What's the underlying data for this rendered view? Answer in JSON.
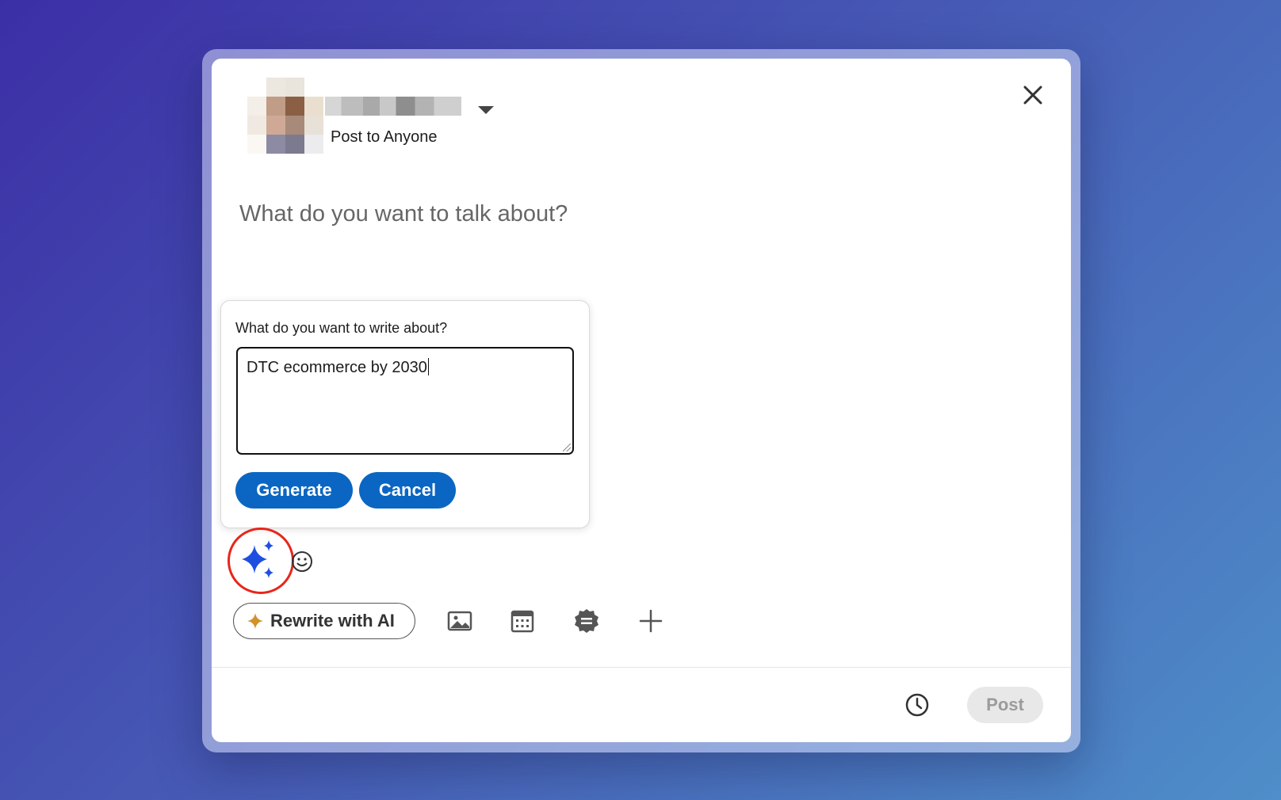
{
  "composer": {
    "audience_label": "Post to Anyone",
    "placeholder": "What do you want to talk about?"
  },
  "ai_prompt": {
    "label": "What do you want to write about?",
    "input_value": "DTC ecommerce by 2030",
    "generate_label": "Generate",
    "cancel_label": "Cancel"
  },
  "toolbar": {
    "rewrite_label": "Rewrite with AI",
    "icons": [
      "ai-sparkle-icon",
      "emoji-icon",
      "image-icon",
      "calendar-icon",
      "badge-icon",
      "plus-icon"
    ]
  },
  "footer": {
    "post_label": "Post",
    "schedule_icon": "clock-icon"
  },
  "colors": {
    "primary": "#0a66c2",
    "highlight": "#e8261b",
    "sparkle": "#1f4fe0",
    "rewrite_star": "#d4912a"
  }
}
